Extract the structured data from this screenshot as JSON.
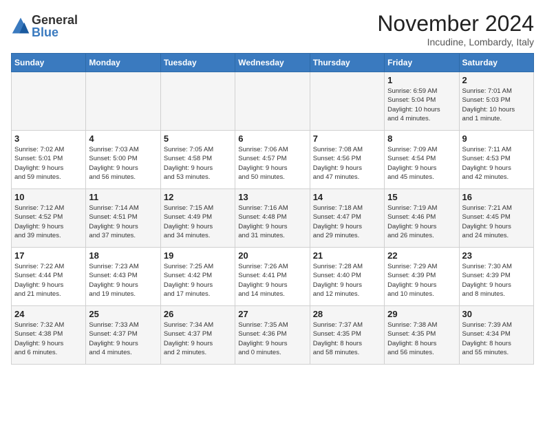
{
  "header": {
    "logo_general": "General",
    "logo_blue": "Blue",
    "month_title": "November 2024",
    "location": "Incudine, Lombardy, Italy"
  },
  "days_of_week": [
    "Sunday",
    "Monday",
    "Tuesday",
    "Wednesday",
    "Thursday",
    "Friday",
    "Saturday"
  ],
  "weeks": [
    [
      {
        "day": "",
        "info": ""
      },
      {
        "day": "",
        "info": ""
      },
      {
        "day": "",
        "info": ""
      },
      {
        "day": "",
        "info": ""
      },
      {
        "day": "",
        "info": ""
      },
      {
        "day": "1",
        "info": "Sunrise: 6:59 AM\nSunset: 5:04 PM\nDaylight: 10 hours\nand 4 minutes."
      },
      {
        "day": "2",
        "info": "Sunrise: 7:01 AM\nSunset: 5:03 PM\nDaylight: 10 hours\nand 1 minute."
      }
    ],
    [
      {
        "day": "3",
        "info": "Sunrise: 7:02 AM\nSunset: 5:01 PM\nDaylight: 9 hours\nand 59 minutes."
      },
      {
        "day": "4",
        "info": "Sunrise: 7:03 AM\nSunset: 5:00 PM\nDaylight: 9 hours\nand 56 minutes."
      },
      {
        "day": "5",
        "info": "Sunrise: 7:05 AM\nSunset: 4:58 PM\nDaylight: 9 hours\nand 53 minutes."
      },
      {
        "day": "6",
        "info": "Sunrise: 7:06 AM\nSunset: 4:57 PM\nDaylight: 9 hours\nand 50 minutes."
      },
      {
        "day": "7",
        "info": "Sunrise: 7:08 AM\nSunset: 4:56 PM\nDaylight: 9 hours\nand 47 minutes."
      },
      {
        "day": "8",
        "info": "Sunrise: 7:09 AM\nSunset: 4:54 PM\nDaylight: 9 hours\nand 45 minutes."
      },
      {
        "day": "9",
        "info": "Sunrise: 7:11 AM\nSunset: 4:53 PM\nDaylight: 9 hours\nand 42 minutes."
      }
    ],
    [
      {
        "day": "10",
        "info": "Sunrise: 7:12 AM\nSunset: 4:52 PM\nDaylight: 9 hours\nand 39 minutes."
      },
      {
        "day": "11",
        "info": "Sunrise: 7:14 AM\nSunset: 4:51 PM\nDaylight: 9 hours\nand 37 minutes."
      },
      {
        "day": "12",
        "info": "Sunrise: 7:15 AM\nSunset: 4:49 PM\nDaylight: 9 hours\nand 34 minutes."
      },
      {
        "day": "13",
        "info": "Sunrise: 7:16 AM\nSunset: 4:48 PM\nDaylight: 9 hours\nand 31 minutes."
      },
      {
        "day": "14",
        "info": "Sunrise: 7:18 AM\nSunset: 4:47 PM\nDaylight: 9 hours\nand 29 minutes."
      },
      {
        "day": "15",
        "info": "Sunrise: 7:19 AM\nSunset: 4:46 PM\nDaylight: 9 hours\nand 26 minutes."
      },
      {
        "day": "16",
        "info": "Sunrise: 7:21 AM\nSunset: 4:45 PM\nDaylight: 9 hours\nand 24 minutes."
      }
    ],
    [
      {
        "day": "17",
        "info": "Sunrise: 7:22 AM\nSunset: 4:44 PM\nDaylight: 9 hours\nand 21 minutes."
      },
      {
        "day": "18",
        "info": "Sunrise: 7:23 AM\nSunset: 4:43 PM\nDaylight: 9 hours\nand 19 minutes."
      },
      {
        "day": "19",
        "info": "Sunrise: 7:25 AM\nSunset: 4:42 PM\nDaylight: 9 hours\nand 17 minutes."
      },
      {
        "day": "20",
        "info": "Sunrise: 7:26 AM\nSunset: 4:41 PM\nDaylight: 9 hours\nand 14 minutes."
      },
      {
        "day": "21",
        "info": "Sunrise: 7:28 AM\nSunset: 4:40 PM\nDaylight: 9 hours\nand 12 minutes."
      },
      {
        "day": "22",
        "info": "Sunrise: 7:29 AM\nSunset: 4:39 PM\nDaylight: 9 hours\nand 10 minutes."
      },
      {
        "day": "23",
        "info": "Sunrise: 7:30 AM\nSunset: 4:39 PM\nDaylight: 9 hours\nand 8 minutes."
      }
    ],
    [
      {
        "day": "24",
        "info": "Sunrise: 7:32 AM\nSunset: 4:38 PM\nDaylight: 9 hours\nand 6 minutes."
      },
      {
        "day": "25",
        "info": "Sunrise: 7:33 AM\nSunset: 4:37 PM\nDaylight: 9 hours\nand 4 minutes."
      },
      {
        "day": "26",
        "info": "Sunrise: 7:34 AM\nSunset: 4:37 PM\nDaylight: 9 hours\nand 2 minutes."
      },
      {
        "day": "27",
        "info": "Sunrise: 7:35 AM\nSunset: 4:36 PM\nDaylight: 9 hours\nand 0 minutes."
      },
      {
        "day": "28",
        "info": "Sunrise: 7:37 AM\nSunset: 4:35 PM\nDaylight: 8 hours\nand 58 minutes."
      },
      {
        "day": "29",
        "info": "Sunrise: 7:38 AM\nSunset: 4:35 PM\nDaylight: 8 hours\nand 56 minutes."
      },
      {
        "day": "30",
        "info": "Sunrise: 7:39 AM\nSunset: 4:34 PM\nDaylight: 8 hours\nand 55 minutes."
      }
    ]
  ]
}
